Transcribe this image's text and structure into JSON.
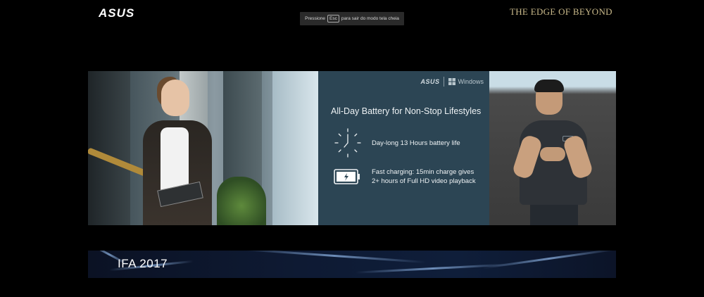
{
  "header": {
    "logo_text": "ASUS",
    "tagline": "THE EDGE OF BEYOND",
    "esc_hint": {
      "before": "Pressione",
      "key": "Esc",
      "after": "para sair do modo tela cheia"
    }
  },
  "slide": {
    "brand_asus": "ASUS",
    "brand_windows": "Windows",
    "title": "All-Day Battery for Non-Stop Lifestyles",
    "features": [
      {
        "icon": "clock-icon",
        "lines": [
          "Day-long 13 Hours battery life"
        ]
      },
      {
        "icon": "battery-charging-icon",
        "lines": [
          "Fast charging: 15min charge gives",
          "2+ hours of Full HD video playback"
        ]
      }
    ]
  },
  "banner": {
    "text": "IFA 2017"
  },
  "colors": {
    "background": "#000000",
    "tagline_gold": "#c9b98a",
    "slide_bg": "#2c4554",
    "banner_bg": "#0e1a33"
  }
}
